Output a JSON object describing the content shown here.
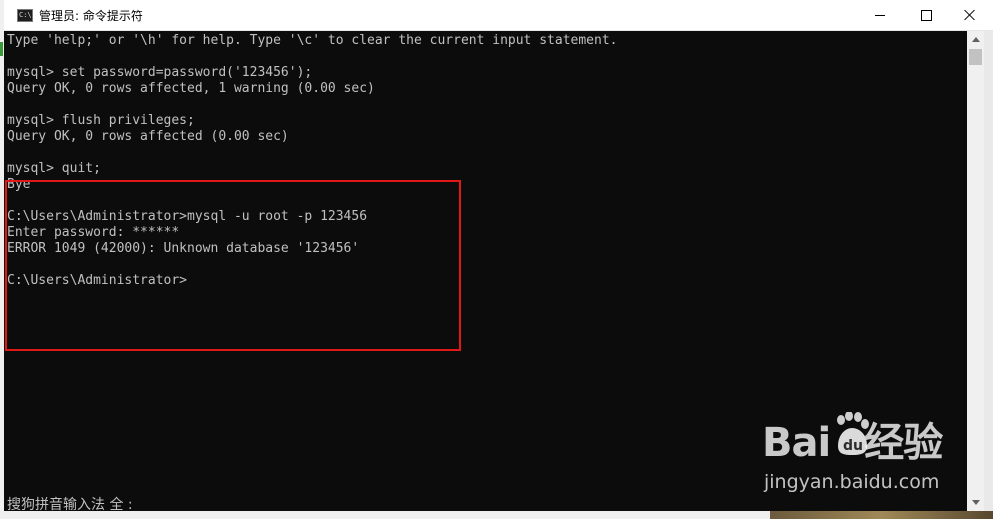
{
  "window": {
    "title": "管理员: 命令提示符",
    "icon_text": "C:\\"
  },
  "console": {
    "lines": [
      "Type 'help;' or '\\h' for help. Type '\\c' to clear the current input statement.",
      "",
      "mysql> set password=password('123456');",
      "Query OK, 0 rows affected, 1 warning (0.00 sec)",
      "",
      "mysql> flush privileges;",
      "Query OK, 0 rows affected (0.00 sec)",
      "",
      "mysql> quit;",
      "Bye",
      "",
      "C:\\Users\\Administrator>mysql -u root -p 123456",
      "Enter password: ******",
      "ERROR 1049 (42000): Unknown database '123456'",
      "",
      "C:\\Users\\Administrator>"
    ]
  },
  "ime": {
    "status": "搜狗拼音输入法 全 :"
  },
  "watermark": {
    "brand_left": "Bai",
    "brand_right": "经验",
    "paw_text": "du",
    "url": "jingyan.baidu.com"
  },
  "colors": {
    "console_bg": "#0c0c0c",
    "console_text": "#c0c0c0",
    "highlight": "#e01818"
  }
}
